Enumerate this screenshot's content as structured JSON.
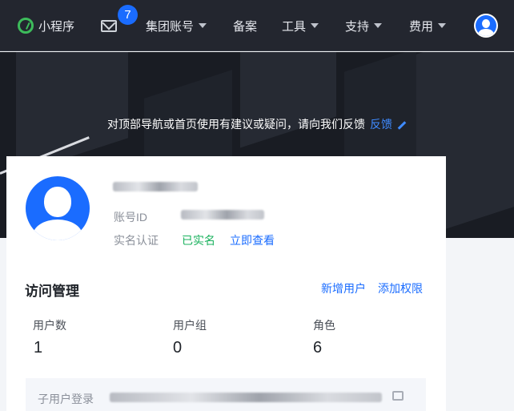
{
  "nav": {
    "mini_program": "小程序",
    "badge_count": "7",
    "group_account": "集团账号",
    "filing": "备案",
    "tools": "工具",
    "support": "支持",
    "billing": "费用"
  },
  "hero": {
    "message": "对顶部导航或首页使用有建议或疑问，请向我们反馈",
    "feedback_link": "反馈"
  },
  "profile": {
    "account_id_label": "账号ID",
    "verify_label": "实名认证",
    "verify_status": "已实名",
    "view_link": "立即查看"
  },
  "access": {
    "title": "访问管理",
    "add_user": "新增用户",
    "add_permission": "添加权限",
    "stats": [
      {
        "label": "用户数",
        "value": "1"
      },
      {
        "label": "用户组",
        "value": "0"
      },
      {
        "label": "角色",
        "value": "6"
      }
    ],
    "sub_login_label": "子用户登录"
  },
  "colors": {
    "accent": "#1a6cff",
    "verified": "#18b15c",
    "nav_bg": "#23262f"
  }
}
